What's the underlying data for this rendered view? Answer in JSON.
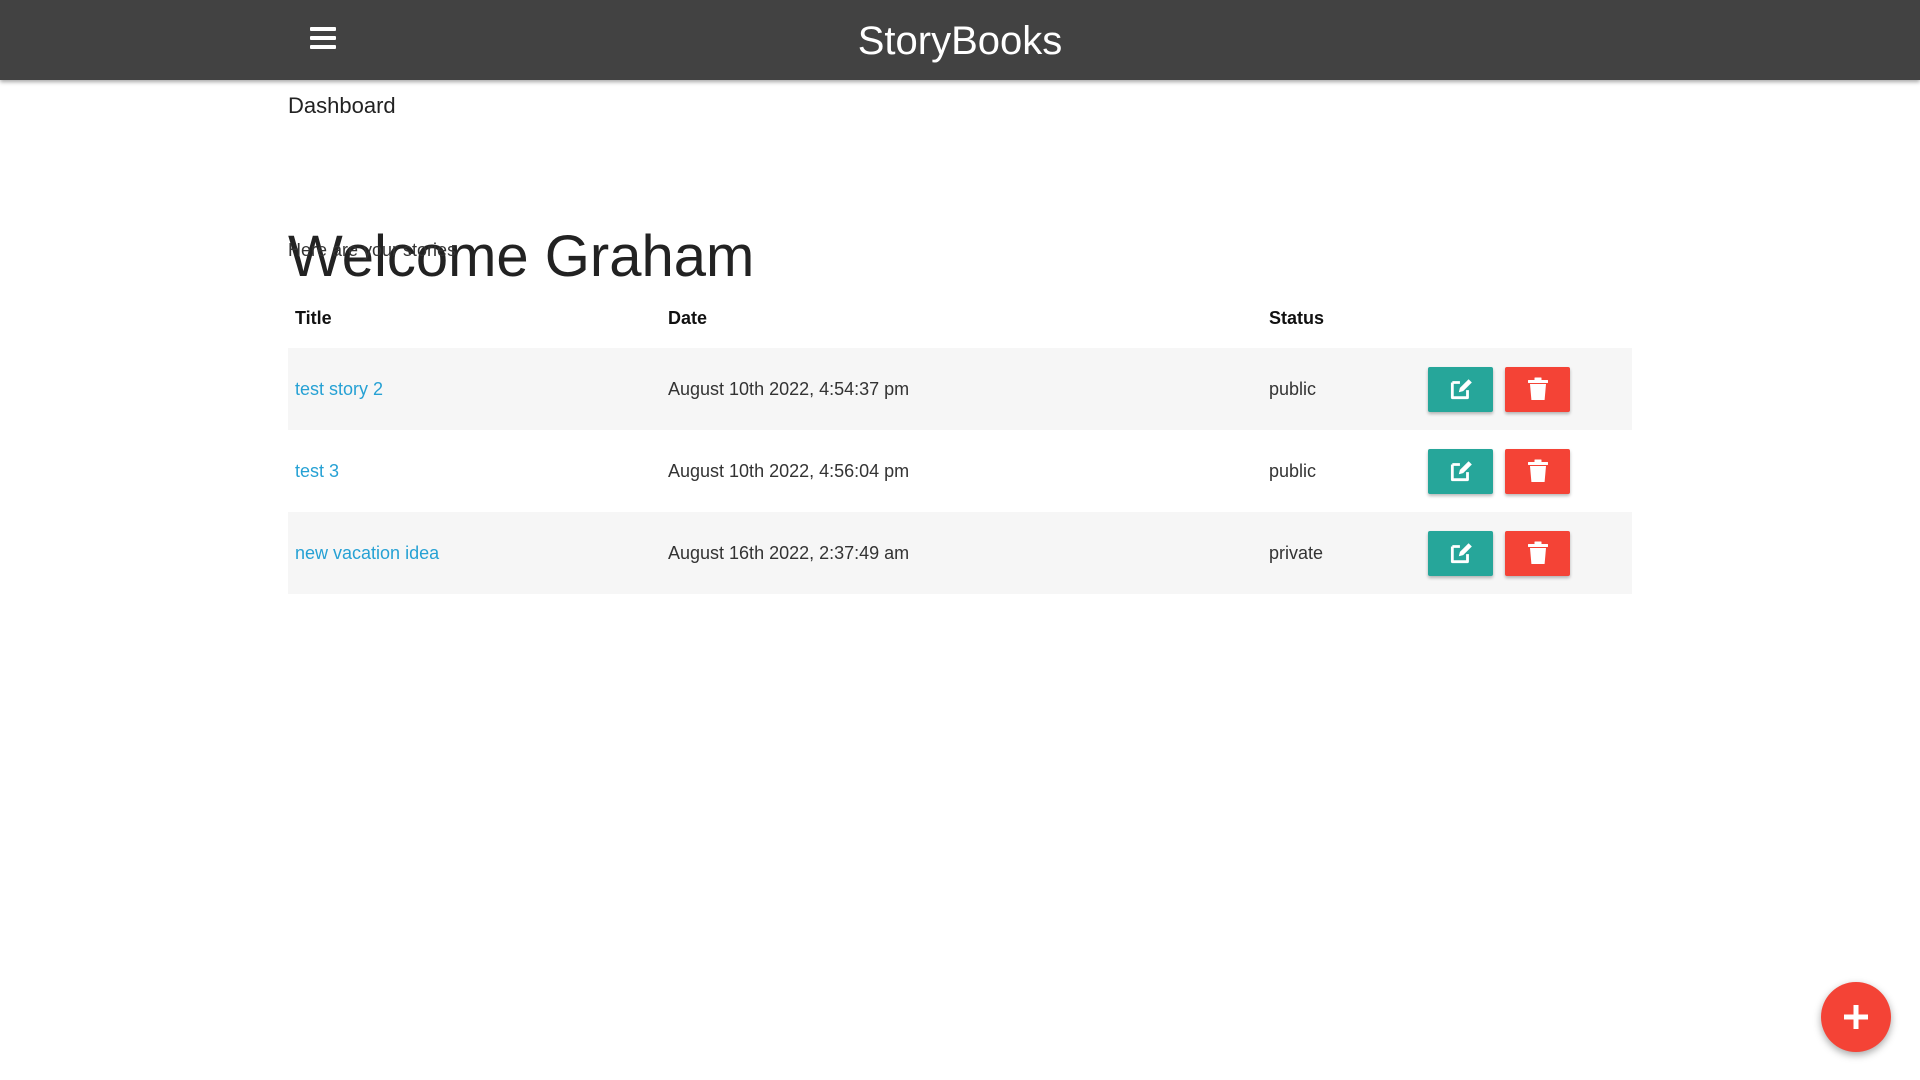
{
  "navbar": {
    "brand": "StoryBooks",
    "menu_icon": "hamburger-menu-icon",
    "background_color": "#424242"
  },
  "page": {
    "label": "Dashboard",
    "welcome": "Welcome Graham",
    "subtext": "Here are your stories"
  },
  "table": {
    "headers": {
      "title": "Title",
      "date": "Date",
      "status": "Status"
    },
    "rows": [
      {
        "title": "test story 2",
        "date": "August 10th 2022, 4:54:37 pm",
        "status": "public"
      },
      {
        "title": "test 3",
        "date": "August 10th 2022, 4:56:04 pm",
        "status": "public"
      },
      {
        "title": "new vacation idea",
        "date": "August 16th 2022, 2:37:49 am",
        "status": "private"
      }
    ],
    "edit_icon": "pencil-square-icon",
    "delete_icon": "trash-icon"
  },
  "fab": {
    "icon": "plus-icon"
  },
  "colors": {
    "link": "#26a1d4",
    "edit_button": "#26a69a",
    "delete_button": "#f44336",
    "row_stripe": "#f6f6f6"
  }
}
